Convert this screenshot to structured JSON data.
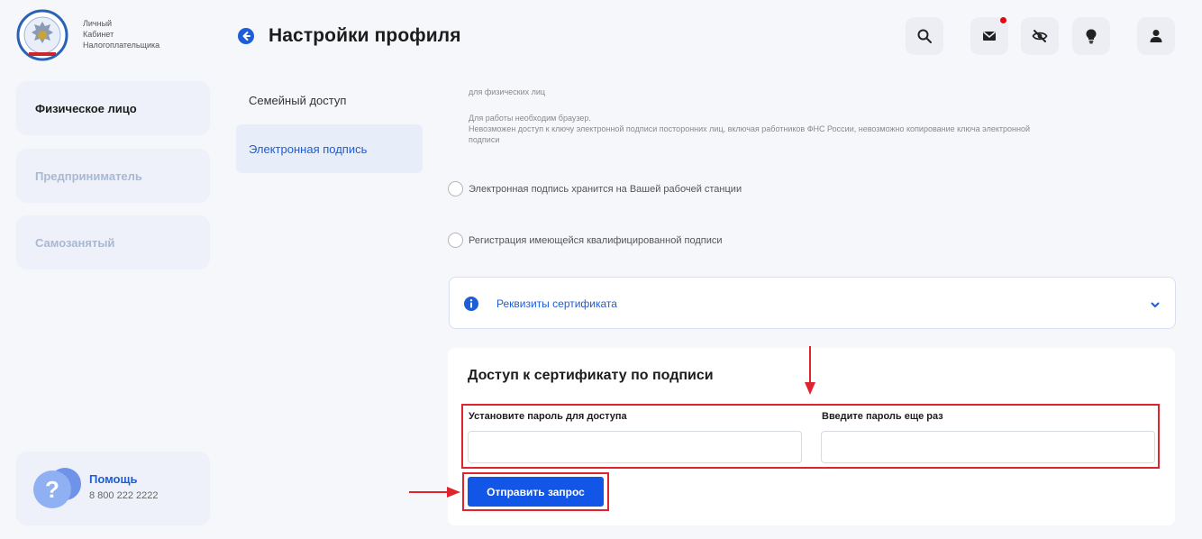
{
  "header": {
    "logo_text": [
      "Личный",
      "Кабинет",
      "Налогоплательщика"
    ],
    "page_title": "Настройки профиля",
    "icons": [
      "back-arrow-icon",
      "search-icon",
      "mail-icon",
      "eye-off-icon",
      "bulb-icon",
      "user-icon"
    ]
  },
  "sidebar": {
    "items": [
      {
        "label": "Физическое лицо",
        "active": true
      },
      {
        "label": "Предприниматель",
        "active": false
      },
      {
        "label": "Самозанятый",
        "active": false
      }
    ],
    "help": {
      "title": "Помощь",
      "phone": "8 800 222 2222"
    }
  },
  "submenu": {
    "items": [
      {
        "label": "Семейный доступ",
        "active": false
      },
      {
        "label": "Электронная подпись",
        "active": true
      }
    ]
  },
  "content": {
    "info_top": "для физических лиц",
    "info_lines": [
      "Для работы необходим браузер.",
      "Невозможен доступ к ключу электронной подписи посторонних лиц, включая работников ФНС России, невозможно копирование ключа электронной",
      "подписи"
    ],
    "radio_options": [
      "Электронная подпись хранится на Вашей рабочей станции",
      "Регистрация имеющейся квалифицированной подписи"
    ],
    "accordion_title": "Реквизиты сертификата",
    "access": {
      "title": "Доступ к сертификату по подписи",
      "password_label": "Установите пароль для доступа",
      "password_value": "",
      "confirm_label": "Введите пароль еще раз",
      "confirm_value": "",
      "submit_label": "Отправить запрос"
    }
  },
  "colors": {
    "accent": "#1d5dd7",
    "button": "#1256e8",
    "annotation_red": "#e0242e",
    "notification_dot": "#e30613"
  }
}
